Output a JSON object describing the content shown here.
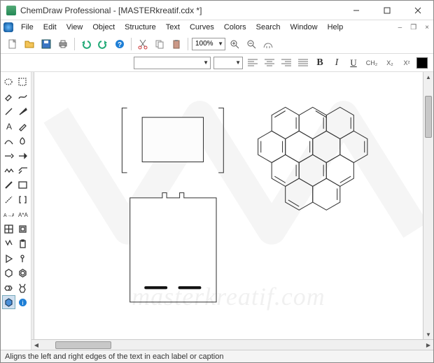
{
  "title": "ChemDraw Professional - [MASTERkreatif.cdx *]",
  "menus": [
    "File",
    "Edit",
    "View",
    "Object",
    "Structure",
    "Text",
    "Curves",
    "Colors",
    "Search",
    "Window",
    "Help"
  ],
  "font_combo": "",
  "size_combo": "",
  "zoom": "100%",
  "fmt": {
    "b": "B",
    "i": "I",
    "u": "U",
    "ch2": "CH₂",
    "x2": "X₂",
    "xsup": "X²"
  },
  "status": "Aligns the left and right edges of the text in each label or caption",
  "watermark": "masterkreatif.com"
}
